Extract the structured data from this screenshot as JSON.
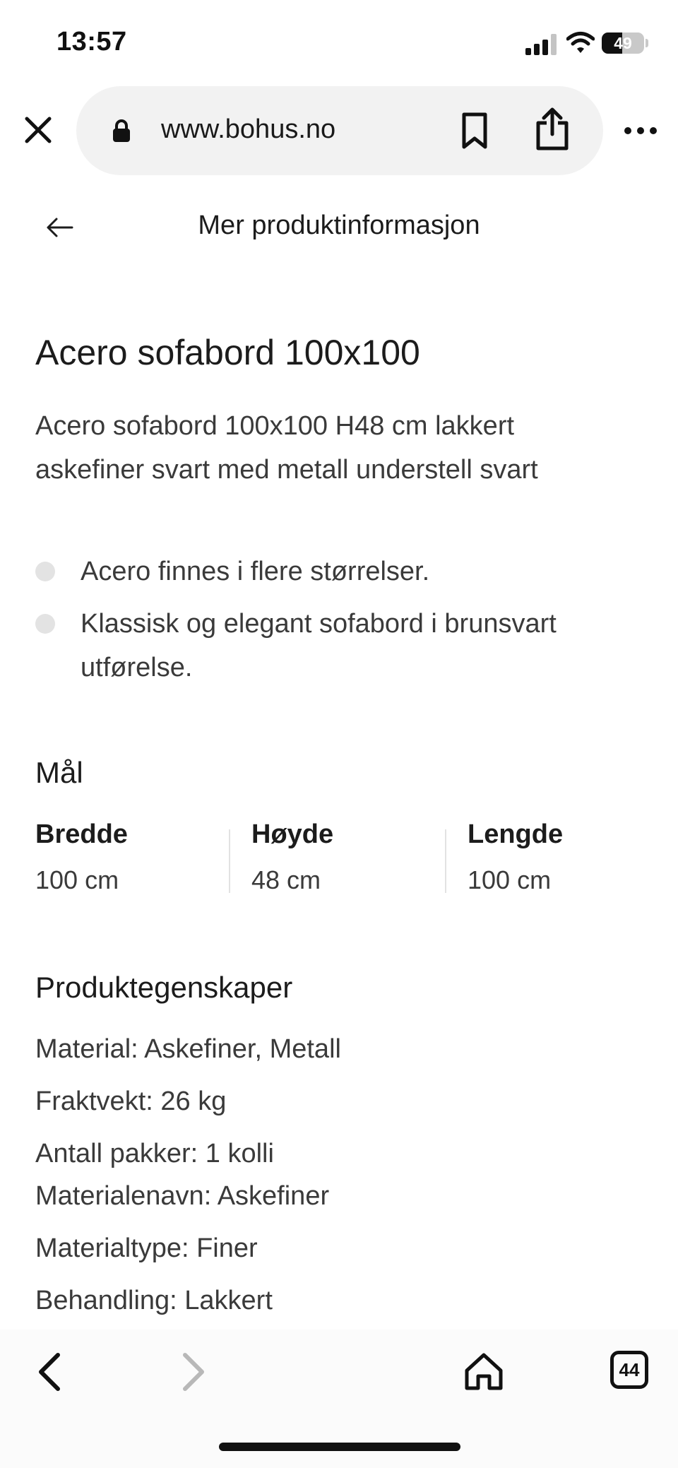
{
  "status": {
    "time": "13:57",
    "battery": "49",
    "battery_level": 0.49
  },
  "browser": {
    "url": "www.bohus.no",
    "tabs_count": "44",
    "icons": [
      "close-icon",
      "lock-icon",
      "bookmark-icon",
      "share-icon",
      "more-icon",
      "back-icon",
      "forward-icon",
      "home-icon",
      "tabs-icon"
    ]
  },
  "header": {
    "title": "Mer produktinformasjon"
  },
  "product": {
    "name": "Acero sofabord 100x100",
    "description": "Acero sofabord 100x100 H48 cm lakkert askefiner svart med metall understell svart",
    "features": [
      "Acero finnes i flere størrelser.",
      "Klassisk og elegant sofabord i brunsvart utførelse."
    ]
  },
  "dimensions": {
    "title": "Mål",
    "items": [
      {
        "label": "Bredde",
        "value": "100 cm"
      },
      {
        "label": "Høyde",
        "value": "48 cm"
      },
      {
        "label": "Lengde",
        "value": "100 cm"
      }
    ]
  },
  "properties": {
    "title": "Produktegenskaper",
    "rows": [
      "Material: Askefiner, Metall",
      "Fraktvekt: 26 kg",
      "Antall pakker: 1 kolli",
      "Materialenavn: Askefiner",
      "Materialtype: Finer",
      "Behandling: Lakkert"
    ]
  },
  "colors": {
    "url_bar_bg": "#f2f2f2",
    "bullet": "#e3e3e3",
    "text": "#3a3a3a",
    "heading": "#1c1c1c"
  }
}
